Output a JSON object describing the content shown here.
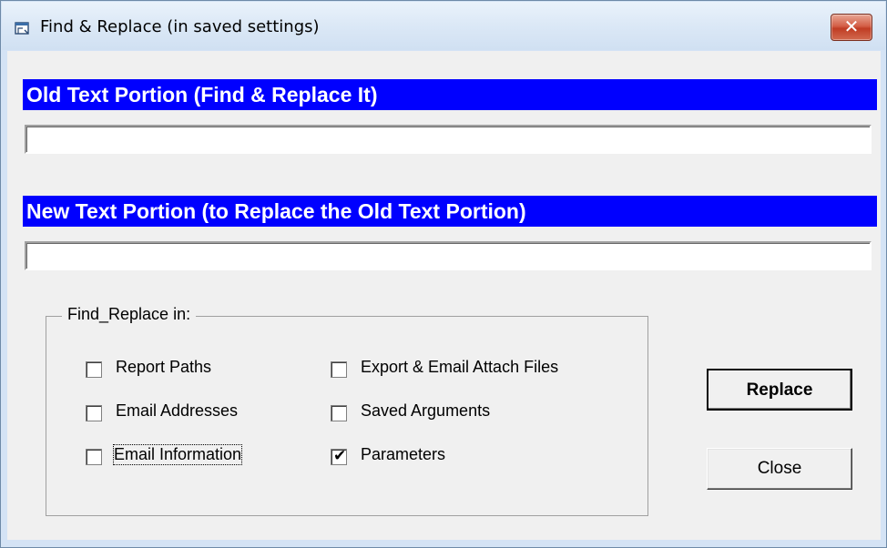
{
  "window": {
    "title": "Find & Replace (in saved settings)",
    "close_glyph": "✕",
    "icon": "window-app-icon"
  },
  "old_text": {
    "label": "Old Text Portion (Find & Replace It)",
    "value": ""
  },
  "new_text": {
    "label": "New Text Portion (to Replace the Old Text Portion)",
    "value": ""
  },
  "group": {
    "label": "Find_Replace in:",
    "options": [
      {
        "label": "Report Paths",
        "checked": false
      },
      {
        "label": "Email Addresses",
        "checked": false
      },
      {
        "label": "Email Information",
        "checked": false
      },
      {
        "label": "Export & Email Attach Files",
        "checked": false
      },
      {
        "label": "Saved Arguments",
        "checked": false
      },
      {
        "label": "Parameters",
        "checked": true
      }
    ]
  },
  "buttons": {
    "replace": "Replace",
    "close": "Close"
  },
  "check_glyph": "✔",
  "colors": {
    "label_bg": "#0000ff",
    "label_text": "#ffffff",
    "dialog_bg": "#f0f0f0"
  }
}
